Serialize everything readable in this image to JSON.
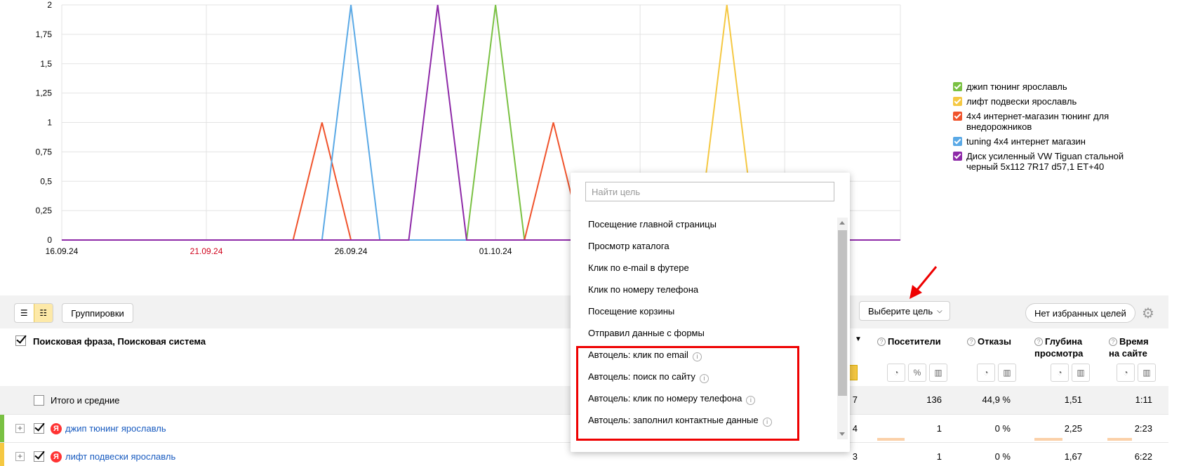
{
  "chart": {
    "y_ticks": [
      "0",
      "0,25",
      "0,5",
      "0,75",
      "1",
      "1,25",
      "1,5",
      "1,75",
      "2"
    ],
    "x_ticks": [
      {
        "label": "16.09.24",
        "weekend": false
      },
      {
        "label": "21.09.24",
        "weekend": true
      },
      {
        "label": "26.09.24",
        "weekend": false
      },
      {
        "label": "01.10.24",
        "weekend": false
      }
    ]
  },
  "chart_data": {
    "type": "line",
    "x": [
      "16.09.24",
      "17.09.24",
      "18.09.24",
      "19.09.24",
      "20.09.24",
      "21.09.24",
      "22.09.24",
      "23.09.24",
      "24.09.24",
      "25.09.24",
      "26.09.24",
      "27.09.24",
      "28.09.24",
      "29.09.24",
      "30.09.24",
      "01.10.24",
      "02.10.24",
      "03.10.24",
      "04.10.24",
      "05.10.24",
      "06.10.24",
      "07.10.24",
      "08.10.24",
      "09.10.24",
      "10.10.24",
      "11.10.24",
      "12.10.24",
      "13.10.24",
      "14.10.24",
      "15.10.24"
    ],
    "ylim": [
      0,
      2
    ],
    "series": [
      {
        "name": "джип тюнинг ярославль",
        "color": "#7ac143",
        "values": [
          0,
          0,
          0,
          0,
          0,
          0,
          0,
          0,
          0,
          0,
          0,
          0,
          0,
          0,
          0,
          2,
          0,
          0,
          0,
          0,
          0,
          0,
          0,
          0,
          0,
          0,
          0,
          0,
          0,
          0
        ]
      },
      {
        "name": "лифт подвески ярославль",
        "color": "#f5c842",
        "values": [
          0,
          0,
          0,
          0,
          0,
          0,
          0,
          0,
          0,
          0,
          0,
          0,
          0,
          0,
          0,
          0,
          0,
          0,
          0,
          0,
          0,
          0,
          0,
          2,
          0,
          0,
          0,
          0,
          0,
          0
        ]
      },
      {
        "name": "4x4 интернет-магазин тюнинг для внедорожников",
        "color": "#f0532c",
        "values": [
          0,
          0,
          0,
          0,
          0,
          0,
          0,
          0,
          0,
          1,
          0,
          0,
          0,
          0,
          0,
          0,
          0,
          1,
          0,
          0,
          0,
          0,
          0,
          0,
          0,
          0,
          0,
          0,
          0,
          0
        ]
      },
      {
        "name": "tuning 4x4 интернет магазин",
        "color": "#5aa9e6",
        "values": [
          0,
          0,
          0,
          0,
          0,
          0,
          0,
          0,
          0,
          0,
          2,
          0,
          0,
          0,
          0,
          0,
          0,
          0,
          0,
          0,
          0,
          0,
          0,
          0,
          0,
          0,
          0,
          0,
          0,
          0
        ]
      },
      {
        "name": "Диск усиленный VW Tiguan стальной черный 5x112 7R17 d57,1 ET+40",
        "color": "#8e2aa8",
        "values": [
          0,
          0,
          0,
          0,
          0,
          0,
          0,
          0,
          0,
          0,
          0,
          0,
          0,
          2,
          0,
          0,
          0,
          0,
          0,
          0,
          0,
          0,
          0,
          0,
          0,
          0,
          0,
          0,
          0,
          0
        ]
      }
    ]
  },
  "legend": [
    {
      "label": "джип тюнинг ярославль",
      "color": "#7ac143"
    },
    {
      "label": "лифт подвески ярославль",
      "color": "#f5c842"
    },
    {
      "label": "4x4 интернет-магазин тюнинг для внедорожников",
      "color": "#f0532c"
    },
    {
      "label": "tuning 4x4 интернет магазин",
      "color": "#5aa9e6"
    },
    {
      "label": "Диск усиленный VW Tiguan стальной черный 5x112 7R17 d57,1 ET+40",
      "color": "#8e2aa8"
    }
  ],
  "toolbar": {
    "groupings_label": "Группировки",
    "select_goal_label": "Выберите цель",
    "favorites_label": "Нет избранных целей"
  },
  "table": {
    "grouping_header": "Поисковая фраза, Поисковая система",
    "columns": {
      "visitors": "Посетители",
      "bounces": "Отказы",
      "depth_1": "Глубина",
      "depth_2": "просмотра",
      "time_1": "Время",
      "time_2": "на сайте"
    },
    "totals": {
      "label": "Итого и средние",
      "partial": "7",
      "visitors": "136",
      "bounces": "44,9 %",
      "depth": "1,51",
      "time": "1:11"
    },
    "rows": [
      {
        "label": "джип тюнинг ярославль",
        "marker": "#7ac143",
        "partial": "4",
        "visitors": "1",
        "visitors_share": 0.43,
        "bounces": "0 %",
        "depth": "2,25",
        "depth_share": 0.56,
        "time": "2:23",
        "time_share": 0.5
      },
      {
        "label": "лифт подвески ярославль",
        "marker": "#f5c842",
        "partial": "3",
        "visitors": "1",
        "visitors_share": 0.43,
        "bounces": "0 %",
        "depth": "1,67",
        "depth_share": 0.42,
        "time": "6:22",
        "time_share": 0.9
      }
    ]
  },
  "goal_dropdown": {
    "search_placeholder": "Найти цель",
    "items": [
      {
        "label": "Посещение главной страницы",
        "info": false
      },
      {
        "label": "Просмотр каталога",
        "info": false
      },
      {
        "label": "Клик по e-mail в футере",
        "info": false
      },
      {
        "label": "Клик по номеру телефона",
        "info": false
      },
      {
        "label": "Посещение корзины",
        "info": false
      },
      {
        "label": "Отправил данные с формы",
        "info": false
      },
      {
        "label": "Автоцель: клик по email",
        "info": true
      },
      {
        "label": "Автоцель: поиск по сайту",
        "info": true
      },
      {
        "label": "Автоцель: клик по номеру телефона",
        "info": true
      },
      {
        "label": "Автоцель: заполнил контактные данные",
        "info": true
      }
    ]
  },
  "icons": {
    "info": "i",
    "question": "?",
    "expand": "+",
    "yandex": "Я",
    "gear": "⚙"
  }
}
